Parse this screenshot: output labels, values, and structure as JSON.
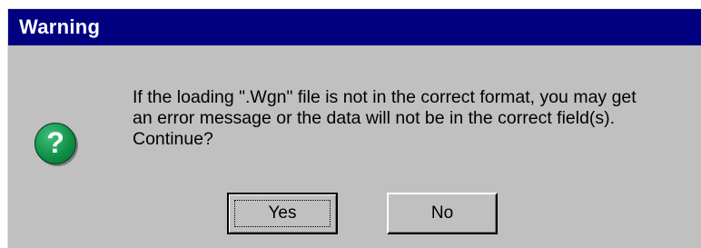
{
  "window": {
    "title": "Warning"
  },
  "icon": {
    "name": "question-icon",
    "glyph": "?",
    "color": "#119048"
  },
  "message": {
    "lines": [
      "If the loading \".Wgn\" file is not in the correct format, you may get",
      "an error message or the data will not be in the correct field(s).",
      "Continue?"
    ]
  },
  "buttons": {
    "yes_label": "Yes",
    "no_label": "No"
  },
  "colors": {
    "titlebar": "#000080",
    "dialog_bg": "#c0c0c0"
  }
}
